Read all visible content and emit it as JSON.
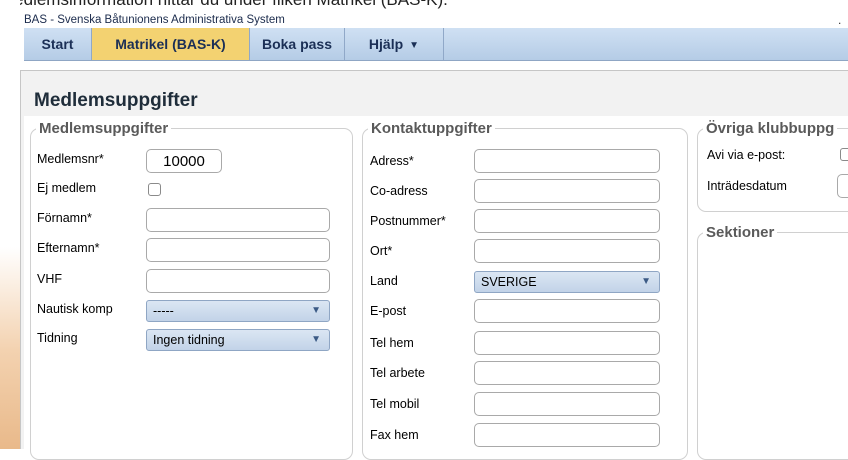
{
  "caption": "Medlemsinformation hittar du under fliken Matrikel (BAS-K).",
  "app": {
    "title": "BAS - Svenska Båtunionens Administrativa System",
    "dot": "."
  },
  "nav": {
    "tabs": [
      {
        "label": "Start"
      },
      {
        "label": "Matrikel (BAS-K)"
      },
      {
        "label": "Boka pass"
      },
      {
        "label": "Hjälp"
      }
    ],
    "active": "Matrikel (BAS-K)"
  },
  "panel_title": "Medlemsuppgifter",
  "member": {
    "legend": "Medlemsuppgifter",
    "medlemsnr": {
      "label": "Medlemsnr*",
      "value": "10000"
    },
    "ej_medlem": {
      "label": "Ej medlem"
    },
    "fornamn": {
      "label": "Förnamn*"
    },
    "efternamn": {
      "label": "Efternamn*"
    },
    "vhf": {
      "label": "VHF"
    },
    "nautisk": {
      "label": "Nautisk komp",
      "value": "-----"
    },
    "tidning": {
      "label": "Tidning",
      "value": "Ingen tidning"
    }
  },
  "contact": {
    "legend": "Kontaktuppgifter",
    "adress": {
      "label": "Adress*"
    },
    "co_adress": {
      "label": "Co-adress"
    },
    "postnummer": {
      "label": "Postnummer*"
    },
    "ort": {
      "label": "Ort*"
    },
    "land": {
      "label": "Land",
      "value": "SVERIGE"
    },
    "epost": {
      "label": "E-post"
    },
    "tel_hem": {
      "label": "Tel hem"
    },
    "tel_arbete": {
      "label": "Tel arbete"
    },
    "tel_mobil": {
      "label": "Tel mobil"
    },
    "fax_hem": {
      "label": "Fax hem"
    }
  },
  "club": {
    "legend": "Övriga klubbuppg",
    "avi": {
      "label": "Avi via e-post:"
    },
    "intradesdatum": {
      "label": "Inträdesdatum"
    }
  },
  "sections": {
    "legend": "Sektioner"
  },
  "colors": {
    "nav_bg": "#c5d7ee",
    "active_tab": "#f3d271",
    "select_bg": "#c8d8ec",
    "legend_text": "#5a5a5a"
  },
  "icons": {
    "dropdown": "chevron-down-icon"
  }
}
